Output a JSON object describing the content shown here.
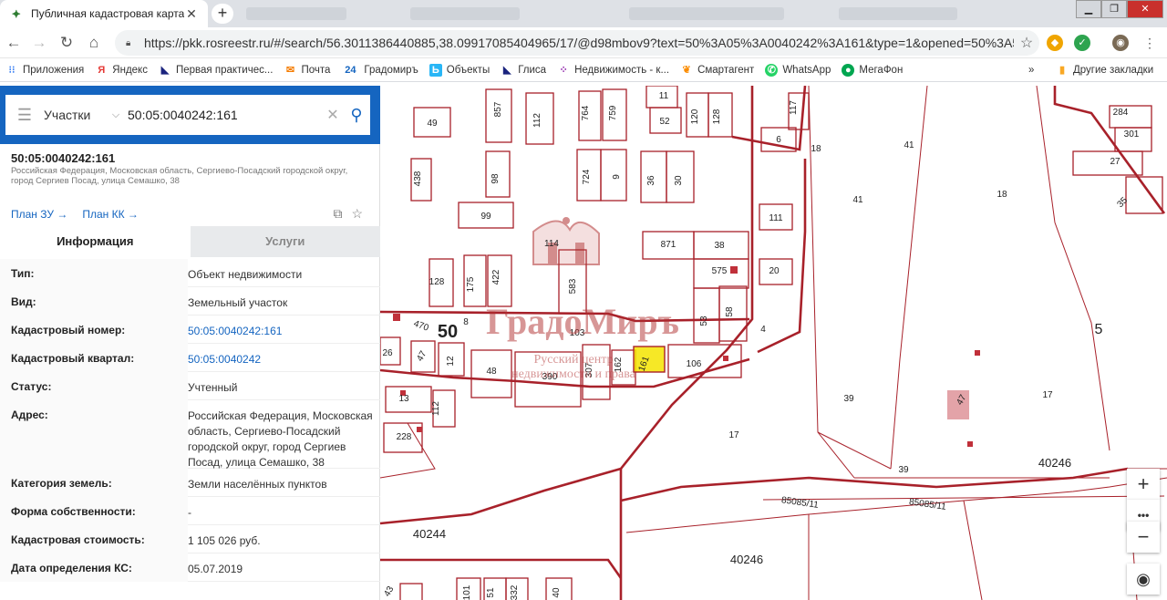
{
  "browser": {
    "tab_title": "Публичная кадастровая карта",
    "new_tab": "+",
    "url": "https://pkk.rosreestr.ru/#/search/56.3011386440885,38.09917085404965/17/@d98mbov9?text=50%3A05%3A0040242%3A161&type=1&opened=50%3A5%3A...",
    "bookmarks": [
      "Приложения",
      "Яндекс",
      "Первая практичес...",
      "Почта",
      "Градомиръ",
      "Объекты",
      "Глиса",
      "Недвижимость - к...",
      "Смартагент",
      "WhatsApp",
      "МегаФон"
    ],
    "other_bookmarks": "Другие закладки"
  },
  "search": {
    "type_label": "Участки",
    "query": "50:05:0040242:161"
  },
  "object": {
    "number": "50:05:0040242:161",
    "address_line": "Российская Федерация, Московская область, Сергиево-Посадский городской округ, город Сергиев Посад, улица Семашко, 38",
    "plan_zu": "План ЗУ →",
    "plan_kk": "План КК →"
  },
  "tabs": {
    "info": "Информация",
    "services": "Услуги"
  },
  "info": [
    {
      "k": "Тип:",
      "v": "Объект недвижимости"
    },
    {
      "k": "Вид:",
      "v": "Земельный участок"
    },
    {
      "k": "Кадастровый номер:",
      "v": "50:05:0040242:161"
    },
    {
      "k": "Кадастровый квартал:",
      "v": "50:05:0040242"
    },
    {
      "k": "Статус:",
      "v": "Учтенный"
    },
    {
      "k": "Адрес:",
      "v": "Российская Федерация, Московская область, Сергиево-Посадский городской округ, город Сергиев Посад, улица Семашко, 38"
    },
    {
      "k": "Категория земель:",
      "v": "Земли населённых пунктов"
    },
    {
      "k": "Форма собственности:",
      "v": "-"
    },
    {
      "k": "Кадастровая стоимость:",
      "v": "1 105 026 руб."
    },
    {
      "k": "Дата определения КС:",
      "v": "05.07.2019"
    }
  ],
  "map": {
    "labels": [
      "49",
      "857",
      "112",
      "764",
      "759",
      "11",
      "52",
      "120",
      "128",
      "117",
      "6",
      "18",
      "41",
      "284",
      "301",
      "27",
      "438",
      "98",
      "724",
      "9",
      "36",
      "30",
      "41",
      "18",
      "35",
      "99",
      "111",
      "114",
      "871",
      "38",
      "128",
      "175",
      "422",
      "583",
      "575",
      "20",
      "53",
      "58",
      "470",
      "50",
      "8",
      "103",
      "4",
      "5",
      "26",
      "47",
      "12",
      "48",
      "390",
      "307",
      "162",
      "161",
      "106",
      "13",
      "112",
      "39",
      "47",
      "17",
      "228",
      "17",
      "39",
      "40246",
      "85085/11",
      "85085/11",
      "40244",
      "40246",
      "51",
      "332",
      "40",
      "101",
      "43"
    ],
    "watermark_name": "ГрадоМиръ",
    "watermark_sub1": "Русский центр",
    "watermark_sub2": "недвижимости и права"
  },
  "controls": {
    "zoom_in": "+",
    "more": "•••",
    "zoom_out": "−",
    "compass": "◉"
  },
  "colors": {
    "parcel": "#a8212a",
    "highlight": "#f5e400",
    "accent": "#1565c0"
  }
}
